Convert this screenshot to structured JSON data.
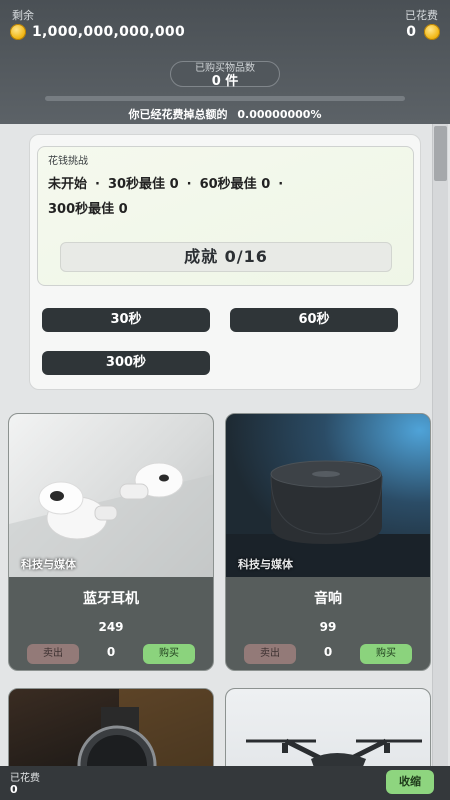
{
  "header": {
    "remaining_label": "剩余",
    "remaining_value": "1,000,000,000,000",
    "spent_label": "已花费",
    "spent_value": "0",
    "purchased_label": "已购买物品数",
    "purchased_value": "0 件",
    "progress_fraction": 0.0,
    "spent_percent_text": "你已经花费掉总额的",
    "spent_percent_value": "0.00000000%"
  },
  "challenge": {
    "title": "花钱挑战",
    "status": "未开始",
    "best30": "30秒最佳 0",
    "best60": "60秒最佳 0",
    "best300": "300秒最佳 0",
    "achievement": "成就  0/16",
    "buttons": [
      "30秒",
      "60秒",
      "300秒"
    ]
  },
  "products": [
    {
      "name": "蓝牙耳机",
      "price": "249",
      "qty": "0",
      "category": "科技与媒体",
      "sell": "卖出",
      "buy": "购买"
    },
    {
      "name": "音响",
      "price": "99",
      "qty": "0",
      "category": "科技与媒体",
      "sell": "卖出",
      "buy": "购买"
    }
  ],
  "bottom": {
    "spent_label": "已花费",
    "spent_value": "0",
    "collapse": "收缩"
  },
  "colors": {
    "accent_green": "#8ed57f",
    "coin_gold": "#f2b818",
    "dark_button": "#2f3538"
  }
}
